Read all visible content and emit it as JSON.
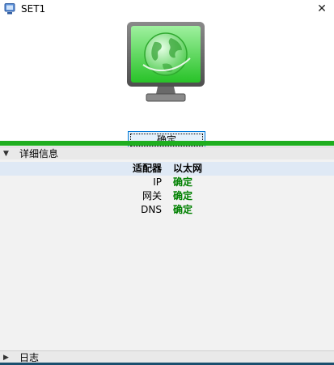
{
  "window": {
    "title": "SET1",
    "close_glyph": "✕"
  },
  "hero": {
    "ok_label": "确定"
  },
  "details": {
    "section_title": "详细信息",
    "rows": [
      {
        "key": "适配器",
        "value": "以太网"
      },
      {
        "key": "IP",
        "value": "确定"
      },
      {
        "key": "网关",
        "value": "确定"
      },
      {
        "key": "DNS",
        "value": "确定"
      }
    ]
  },
  "log": {
    "section_title": "日志"
  },
  "colors": {
    "accent_green": "#1fae1f",
    "status_ok": "#008000",
    "header_row": "#dfe9f5"
  },
  "icons": [
    "app-monitor-icon",
    "close-icon",
    "globe-monitor-icon",
    "caret-down-icon",
    "caret-right-icon"
  ]
}
